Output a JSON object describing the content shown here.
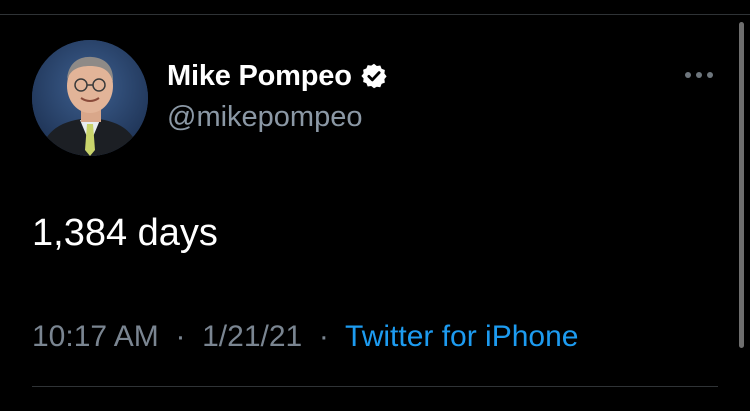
{
  "tweet": {
    "author": {
      "display_name": "Mike Pompeo",
      "handle": "@mikepompeo",
      "verified": true
    },
    "text": "1,384 days",
    "time": "10:17 AM",
    "date": "1/21/21",
    "separator": "·",
    "source": "Twitter for iPhone"
  },
  "icons": {
    "verified": "verified-badge-icon",
    "more": "more-options-icon"
  },
  "colors": {
    "background": "#000000",
    "name": "#ffffff",
    "secondary_text": "#8b98a5",
    "link": "#1d9bf0"
  }
}
